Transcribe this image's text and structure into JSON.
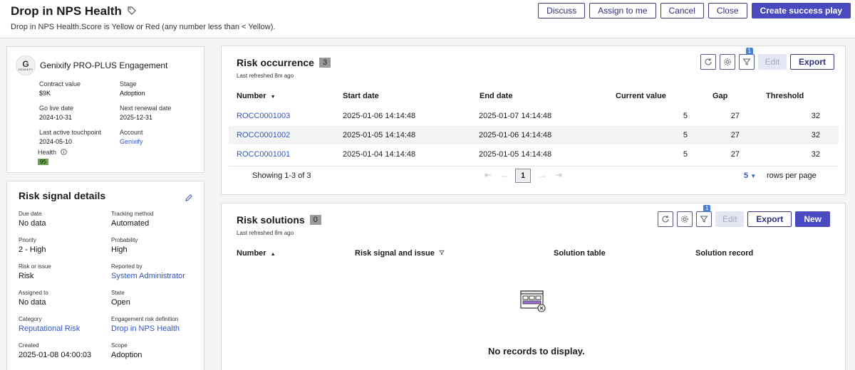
{
  "header": {
    "title": "Drop in NPS Health",
    "description": "Drop in NPS Health.Score is Yellow or Red (any number less than < Yellow).",
    "actions": {
      "discuss": "Discuss",
      "assign": "Assign to me",
      "cancel": "Cancel",
      "close": "Close",
      "create_play": "Create success play"
    }
  },
  "engagement": {
    "logo_text": "G",
    "logo_brand": "GENIXIFY",
    "title": "Genixify PRO-PLUS Engagement",
    "fields": {
      "contract_value_label": "Contract value",
      "contract_value": "$9K",
      "stage_label": "Stage",
      "stage": "Adoption",
      "go_live_label": "Go live date",
      "go_live": "2024-10-31",
      "renewal_label": "Next renewal date",
      "renewal": "2025-12-31",
      "touchpoint_label": "Last active touchpoint",
      "touchpoint": "2024-05-10",
      "account_label": "Account",
      "account": "Genixify",
      "health_label": "Health",
      "health": "95"
    }
  },
  "risk_signal": {
    "title": "Risk signal details",
    "fields": {
      "due_date_label": "Due date",
      "due_date": "No data",
      "tracking_label": "Tracking method",
      "tracking": "Automated",
      "priority_label": "Priority",
      "priority": "2 - High",
      "probability_label": "Probability",
      "probability": "High",
      "risk_issue_label": "Risk or issue",
      "risk_issue": "Risk",
      "reported_by_label": "Reported by",
      "reported_by": "System Administrator",
      "assigned_to_label": "Assigned to",
      "assigned_to": "No data",
      "state_label": "State",
      "state": "Open",
      "category_label": "Category",
      "category": "Reputational Risk",
      "definition_label": "Engagement risk definition",
      "definition": "Drop in NPS Health",
      "created_label": "Created",
      "created": "2025-01-08 04:00:03",
      "scope_label": "Scope",
      "scope": "Adoption"
    }
  },
  "risk_occurrence": {
    "title": "Risk occurrence",
    "count": "3",
    "refreshed": "Last refreshed 8m ago",
    "filter_badge": "1",
    "edit": "Edit",
    "export": "Export",
    "columns": {
      "number": "Number",
      "start": "Start date",
      "end": "End date",
      "current": "Current value",
      "gap": "Gap",
      "threshold": "Threshold"
    },
    "rows": [
      {
        "number": "ROCC0001003",
        "start": "2025-01-06 14:14:48",
        "end": "2025-01-07 14:14:48",
        "current": "5",
        "gap": "27",
        "threshold": "32"
      },
      {
        "number": "ROCC0001002",
        "start": "2025-01-05 14:14:48",
        "end": "2025-01-06 14:14:48",
        "current": "5",
        "gap": "27",
        "threshold": "32"
      },
      {
        "number": "ROCC0001001",
        "start": "2025-01-04 14:14:48",
        "end": "2025-01-05 14:14:48",
        "current": "5",
        "gap": "27",
        "threshold": "32"
      }
    ],
    "pager": {
      "showing": "Showing 1-3 of 3",
      "page": "1",
      "rows_per_page_value": "5",
      "rows_per_page_label": "rows per page"
    }
  },
  "risk_solutions": {
    "title": "Risk solutions",
    "count": "0",
    "refreshed": "Last refreshed 8m ago",
    "filter_badge": "1",
    "edit": "Edit",
    "export": "Export",
    "new": "New",
    "columns": {
      "number": "Number",
      "signal": "Risk signal and issue",
      "table": "Solution table",
      "record": "Solution record"
    },
    "empty": "No records to display."
  },
  "colors": {
    "primary": "#4b49c0",
    "link": "#2f56c7",
    "health": "#6aa84f",
    "badge": "#4b7fd1"
  }
}
